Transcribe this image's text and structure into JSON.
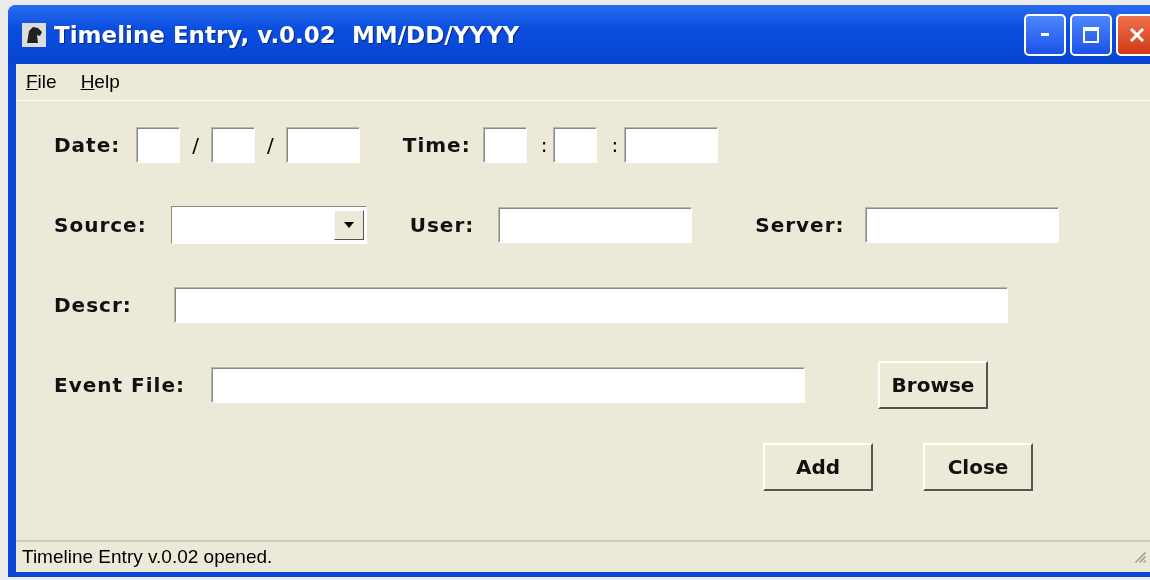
{
  "window": {
    "title": "Timeline Entry, v.0.02  MM/DD/YYYY"
  },
  "menu": [
    "File",
    "Help"
  ],
  "form": {
    "date_label": "Date:",
    "date_sep_1": "/",
    "date_sep_2": "/",
    "time_label": "Time:",
    "time_sep_1": ":",
    "time_sep_2": ":",
    "source_label": "Source:",
    "user_label": "User:",
    "server_label": "Server:",
    "descr_label": "Descr:",
    "event_file_label": "Event File:"
  },
  "buttons": {
    "browse": "Browse",
    "add": "Add",
    "close": "Close"
  },
  "status_bar": "Timeline Entry v.0.02 opened."
}
